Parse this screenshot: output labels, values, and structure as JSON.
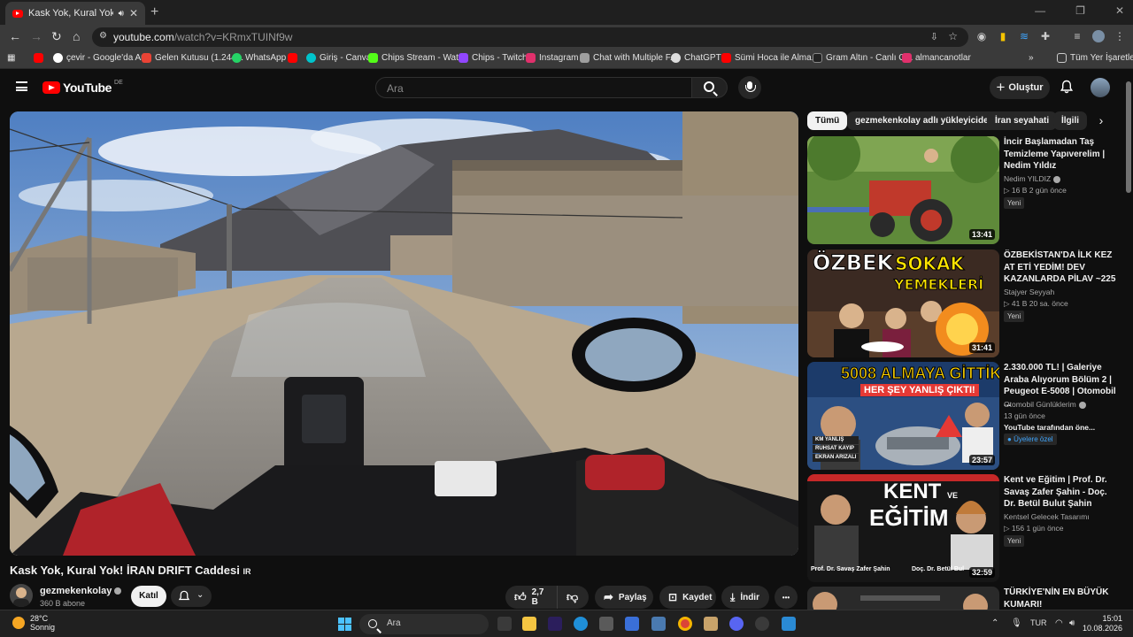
{
  "browser": {
    "tab_title": "Kask Yok, Kural Yok! İRAN D",
    "url_host": "youtube.com",
    "url_path": "/watch?v=KRmxTUINf9w",
    "bookmarks": [
      {
        "label": "",
        "color": "#ff0000"
      },
      {
        "label": "çevir - Google'da Ara",
        "color": "#4285f4"
      },
      {
        "label": "Gelen Kutusu (1.244...",
        "color": "#ea4335"
      },
      {
        "label": "WhatsApp",
        "color": "#25d366"
      },
      {
        "label": "",
        "color": "#ff0000"
      },
      {
        "label": "Giriş - Canva",
        "color": "#00c4cc"
      },
      {
        "label": "Chips Stream - Wat...",
        "color": "#53fc18"
      },
      {
        "label": "Chips - Twitch",
        "color": "#9146ff"
      },
      {
        "label": "Instagram",
        "color": "#e1306c"
      },
      {
        "label": "Chat with Multiple F...",
        "color": "#9e9e9e"
      },
      {
        "label": "ChatGPT",
        "color": "#dddddd"
      },
      {
        "label": "Sümi Hoca ile Alma...",
        "color": "#ff0000"
      },
      {
        "label": "Gram Altın - Canlı G...",
        "color": "#222222"
      },
      {
        "label": "almancanotlar",
        "color": "#e1306c"
      }
    ],
    "all_bookmarks": "Tüm Yer İşaretleri"
  },
  "youtube": {
    "logo_text": "YouTube",
    "country": "DE",
    "search_placeholder": "Ara",
    "create_label": "Oluştur"
  },
  "video": {
    "title": "Kask Yok, Kural Yok! İRAN DRIFT Caddesi",
    "flag": "IR",
    "channel": "gezmekenkolay",
    "subscribers": "360 B abone",
    "join_label": "Katıl",
    "likes": "2,7 B",
    "share_label": "Paylaş",
    "save_label": "Kaydet",
    "download_label": "İndir",
    "more_label": "•••"
  },
  "chips": [
    "Tümü",
    "gezmekenkolay adlı yükleyiciden",
    "İran seyahati",
    "İlgili"
  ],
  "recommendations": [
    {
      "title": "İncir Başlamadan Taş Temizleme Yapıverelim | Nedim Yıldız",
      "channel": "Nedim YILDIZ",
      "views": "▷ 16 B",
      "age": "2 gün önce",
      "badge": "Yeni",
      "duration": "13:41"
    },
    {
      "title": "ÖZBEKİSTAN'DA İLK KEZ AT ETİ YEDİM! DEV KAZANLARDA PİLAV ~225",
      "channel": "Stajyer Seyyah",
      "views": "▷ 41 B",
      "age": "20 sa. önce",
      "badge": "Yeni",
      "duration": "31:41",
      "thumb_text1": "ÖZBEK",
      "thumb_text2": "SOKAK",
      "thumb_text3": "YEMEKLERİ"
    },
    {
      "title": "2.330.000 TL! | Galeriye Araba Alıyorum Bölüm 2 | Peugeot E-5008 | Otomobil ...",
      "channel": "Otomobil Günlüklerim",
      "views": "13 gün önce",
      "age": "YouTube tarafından öne...",
      "badge": "Üyelere özel",
      "duration": "23:57",
      "thumb_text1": "5008 ALMAYA GİTTİK!",
      "thumb_text2": "HER ŞEY YANLIŞ ÇIKTI!",
      "thumb_tags": [
        "KM YANLIŞ",
        "RUHSAT KAYIP",
        "EKRAN ARIZALI"
      ]
    },
    {
      "title": "Kent ve Eğitim | Prof. Dr. Savaş Zafer Şahin - Doç. Dr. Betül Bulut Şahin",
      "channel": "Kentsel Gelecek Tasarımı",
      "views": "▷ 156",
      "age": "1 gün önce",
      "badge": "Yeni",
      "duration": "32:59",
      "thumb_text1": "KENT",
      "thumb_text2": "VE",
      "thumb_text3": "EĞİTİM",
      "thumb_names": [
        "Prof. Dr. Savaş Zafer Şahin",
        "Doç. Dr. Betül Bul"
      ]
    },
    {
      "title": "TÜRKİYE'NİN EN BÜYÜK KUMARI!"
    }
  ],
  "taskbar": {
    "temperature": "28°C",
    "weather": "Sonnig",
    "search_placeholder": "Ara",
    "lang": "TUR",
    "time": "15:01",
    "date": "10.08.2026"
  }
}
